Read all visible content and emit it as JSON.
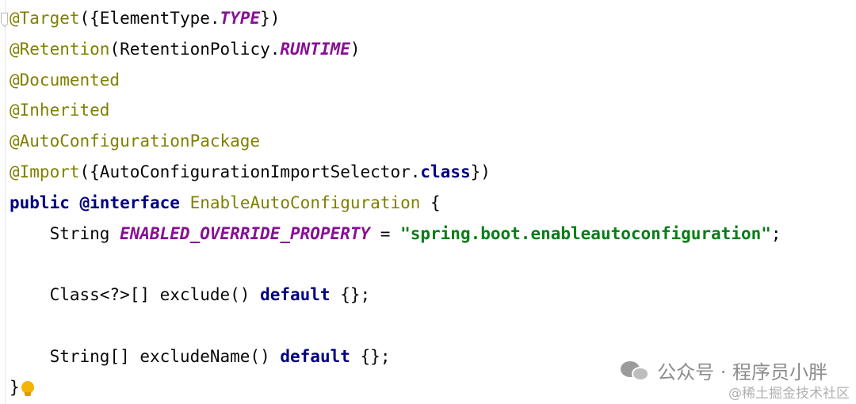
{
  "editor": {
    "lines": [
      {
        "tokens": [
          {
            "t": "@Target",
            "c": "ann"
          },
          {
            "t": "({ElementType.",
            "c": "plain"
          },
          {
            "t": "TYPE",
            "c": "const"
          },
          {
            "t": "})",
            "c": "plain"
          }
        ]
      },
      {
        "tokens": [
          {
            "t": "@Retention",
            "c": "ann"
          },
          {
            "t": "(RetentionPolicy.",
            "c": "plain"
          },
          {
            "t": "RUNTIME",
            "c": "const"
          },
          {
            "t": ")",
            "c": "plain"
          }
        ]
      },
      {
        "tokens": [
          {
            "t": "@Documented",
            "c": "ann"
          }
        ]
      },
      {
        "tokens": [
          {
            "t": "@Inherited",
            "c": "ann"
          }
        ]
      },
      {
        "tokens": [
          {
            "t": "@AutoConfigurationPackage",
            "c": "ann"
          }
        ]
      },
      {
        "tokens": [
          {
            "t": "@Import",
            "c": "ann"
          },
          {
            "t": "({AutoConfigurationImportSelector.",
            "c": "plain"
          },
          {
            "t": "class",
            "c": "kw"
          },
          {
            "t": "})",
            "c": "plain"
          }
        ]
      },
      {
        "tokens": [
          {
            "t": "public",
            "c": "kw"
          },
          {
            "t": " ",
            "c": "plain"
          },
          {
            "t": "@interface",
            "c": "kw"
          },
          {
            "t": " ",
            "c": "plain"
          },
          {
            "t": "EnableAutoConfiguration",
            "c": "ann"
          },
          {
            "t": " {",
            "c": "plain"
          }
        ]
      },
      {
        "tokens": [
          {
            "t": "    String ",
            "c": "plain"
          },
          {
            "t": "ENABLED_OVERRIDE_PROPERTY",
            "c": "const"
          },
          {
            "t": " = ",
            "c": "plain"
          },
          {
            "t": "\"spring.boot.enableautoconfiguration\"",
            "c": "str"
          },
          {
            "t": ";",
            "c": "plain"
          }
        ]
      },
      {
        "tokens": []
      },
      {
        "tokens": [
          {
            "t": "    Class<?>[] exclude() ",
            "c": "plain"
          },
          {
            "t": "default",
            "c": "kw"
          },
          {
            "t": " {};",
            "c": "plain"
          }
        ]
      },
      {
        "tokens": []
      },
      {
        "tokens": [
          {
            "t": "    String[] excludeName() ",
            "c": "plain"
          },
          {
            "t": "default",
            "c": "kw"
          },
          {
            "t": " {};",
            "c": "plain"
          }
        ]
      },
      {
        "tokens": [
          {
            "t": "}",
            "c": "plain"
          }
        ],
        "bulb": true
      }
    ]
  },
  "icons": {
    "bulb": "lightbulb-icon",
    "fold": "fold-marker-icon",
    "wechat": "wechat-icon"
  },
  "watermark": {
    "primary": "公众号 · 程序员小胖",
    "secondary": "@稀土掘金技术社区"
  },
  "colors": {
    "annotation": "#808000",
    "keyword": "#000080",
    "constant": "#871094",
    "string": "#067d17",
    "text": "#080808",
    "bulb": "#f4b400"
  }
}
